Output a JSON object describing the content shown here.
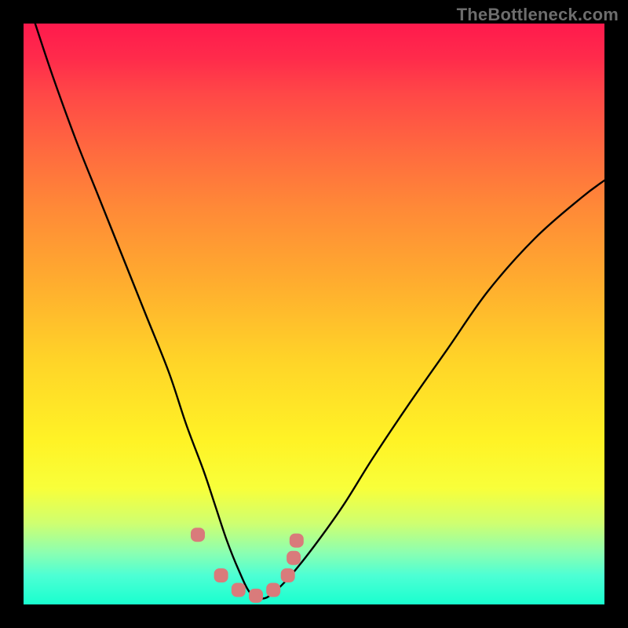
{
  "watermark": "TheBottleneck.com",
  "chart_data": {
    "type": "line",
    "title": "",
    "xlabel": "",
    "ylabel": "",
    "xlim": [
      0,
      100
    ],
    "ylim": [
      0,
      100
    ],
    "grid": false,
    "legend": false,
    "series": [
      {
        "name": "bottleneck-curve",
        "x": [
          2,
          5,
          9,
          13,
          17,
          21,
          25,
          28,
          31,
          33,
          35,
          37,
          39,
          41,
          43,
          46,
          50,
          55,
          60,
          66,
          73,
          80,
          88,
          96,
          100
        ],
        "values": [
          100,
          91,
          80,
          70,
          60,
          50,
          40,
          31,
          23,
          17,
          11,
          6,
          2,
          1,
          2,
          5,
          10,
          17,
          25,
          34,
          44,
          54,
          63,
          70,
          73
        ]
      }
    ],
    "annotations": [
      {
        "name": "marker-cluster",
        "shape": "round",
        "color": "#d97b7b",
        "points_xy": [
          [
            30.0,
            12.0
          ],
          [
            34.0,
            5.0
          ],
          [
            37.0,
            2.5
          ],
          [
            40.0,
            1.5
          ],
          [
            43.0,
            2.5
          ],
          [
            45.5,
            5.0
          ],
          [
            46.5,
            8.0
          ],
          [
            47.0,
            11.0
          ]
        ]
      }
    ],
    "gradient_stops": [
      {
        "pct": 0,
        "color": "#ff1a4d"
      },
      {
        "pct": 22,
        "color": "#ff6a3f"
      },
      {
        "pct": 58,
        "color": "#ffd428"
      },
      {
        "pct": 80,
        "color": "#f8ff3a"
      },
      {
        "pct": 100,
        "color": "#19ffcf"
      }
    ]
  }
}
